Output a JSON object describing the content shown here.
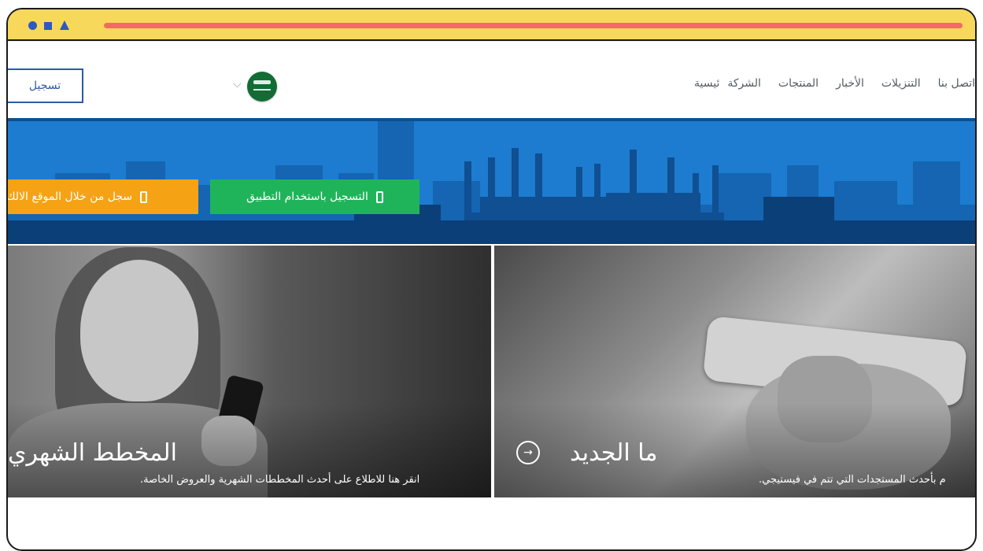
{
  "colors": {
    "chrome_bar": "#f8d85a",
    "address_line": "#f26b63",
    "window_controls": "#2f56c8",
    "register_border": "#2c5aa8",
    "banner": "#1d7ccf",
    "app_button": "#20b45a",
    "web_button": "#f5a314"
  },
  "header": {
    "register_label": "تسجيل",
    "flag_icon": "saudi-flag-icon",
    "nav": [
      "ئيسية",
      "الشركة",
      "المنتجات",
      "الأخبار",
      "التنزيلات",
      "اتصل بنا"
    ]
  },
  "banner": {
    "app_button_label": "التسجيل باستخدام التطبيق",
    "web_button_label": "سجل من خلال الموقع الالك",
    "button_icon": "phone-icon"
  },
  "panels": {
    "left": {
      "title": "المخطط الشهري",
      "subtitle": "انقر هنا للاطلاع على أحدث المخططات الشهرية والعروض الخاصة."
    },
    "right": {
      "title": "ما الجديد",
      "subtitle": "م بأحدث المستجدات التي تتم في فيستيجي.",
      "icon": "arrow-right-circle-icon"
    }
  }
}
